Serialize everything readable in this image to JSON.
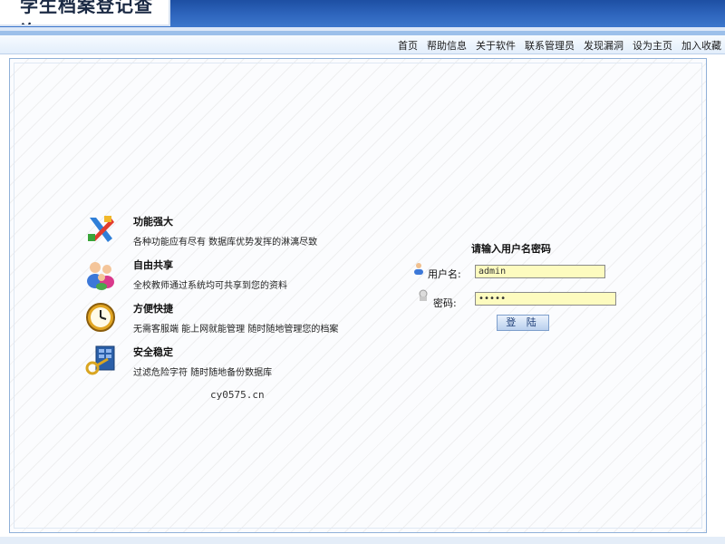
{
  "header": {
    "logo_text": "学生档案登记查询"
  },
  "nav": {
    "links": [
      "首页",
      "帮助信息",
      "关于软件",
      "联系管理员",
      "发现漏洞",
      "设为主页",
      "加入收藏"
    ]
  },
  "features": [
    {
      "title": "功能强大",
      "desc": "各种功能应有尽有  数据库优势发挥的淋漓尽致",
      "icon": "tools-icon"
    },
    {
      "title": "自由共享",
      "desc": "全校教师通过系统均可共享到您的资料",
      "icon": "users-icon"
    },
    {
      "title": "方便快捷",
      "desc": "无需客服端  能上网就能管理  随时随地管理您的档案",
      "icon": "clock-icon"
    },
    {
      "title": "安全稳定",
      "desc": "过滤危险字符  随时随地备份数据库",
      "icon": "security-key-icon"
    }
  ],
  "site": "cy0575.cn",
  "login": {
    "title": "请输入用户名密码",
    "username_label": "用户名:",
    "username_value": "admin",
    "password_label": "密码:",
    "password_value": "admin",
    "button_label": "登 陆"
  },
  "colors": {
    "header_blue": "#2f66be",
    "input_bg": "#fdfbbf",
    "panel_border": "#8fb0d8"
  }
}
